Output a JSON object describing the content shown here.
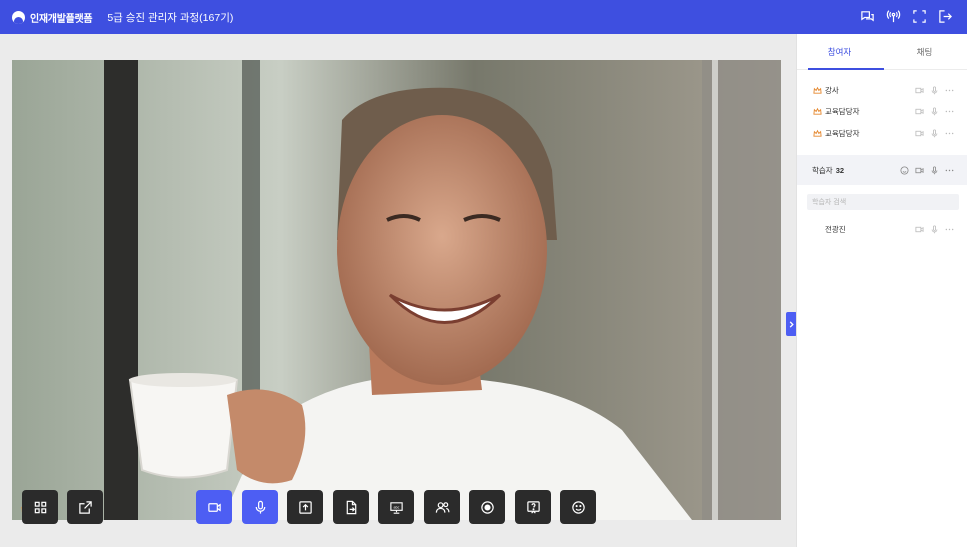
{
  "header": {
    "logo_text": "인재개발플랫폼",
    "title": "5급 승진 관리자 과정(167기)",
    "icons": [
      "chat-icon",
      "broadcast-icon",
      "fullscreen-icon",
      "logout-icon"
    ]
  },
  "video": {
    "speaker_name": "강사"
  },
  "controls": {
    "left": [
      "layout-grid-icon",
      "popout-icon"
    ],
    "center": [
      "camera-icon",
      "microphone-icon",
      "share-screen-icon",
      "file-share-icon",
      "whiteboard-icon",
      "participants-icon",
      "record-icon",
      "question-icon",
      "reaction-icon"
    ],
    "whiteboard_glyph": "abc"
  },
  "sidebar": {
    "tabs": [
      {
        "label": "참여자",
        "active": true
      },
      {
        "label": "채팅",
        "active": false
      }
    ],
    "hosts": [
      {
        "name": "강사",
        "role": "crown"
      },
      {
        "name": "교육담당자",
        "role": "crown"
      },
      {
        "name": "교육담당자",
        "role": "crown"
      }
    ],
    "learners": {
      "label": "학습자",
      "count": "32",
      "search_placeholder": "학습자 검색",
      "items": [
        {
          "name": "전광진"
        }
      ]
    }
  },
  "colors": {
    "brand": "#3e4fe0",
    "active_control": "#4d5ef3",
    "crown": "#e5872d"
  }
}
